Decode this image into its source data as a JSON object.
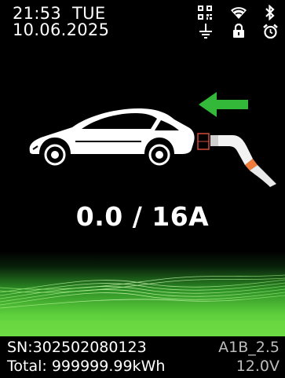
{
  "status_bar": {
    "time": "21:53",
    "day": "TUE",
    "date": "10.06.2025",
    "icons": [
      "qr-code-icon",
      "wifi-icon",
      "bluetooth-icon",
      "ground-icon",
      "lock-icon",
      "alarm-clock-icon"
    ]
  },
  "charging": {
    "current_reading": "0.0 / 16A",
    "direction": "plug-to-car",
    "accent_color": "#2fbf3a",
    "cable_tip_color": "#f07a3a"
  },
  "footer": {
    "serial": "SN:302502080123",
    "model": "A1B_2.5",
    "total_energy": "Total: 999999.99kWh",
    "voltage": "12.0V"
  },
  "colors": {
    "background": "#000000",
    "wave_green": "#5fd13d"
  }
}
